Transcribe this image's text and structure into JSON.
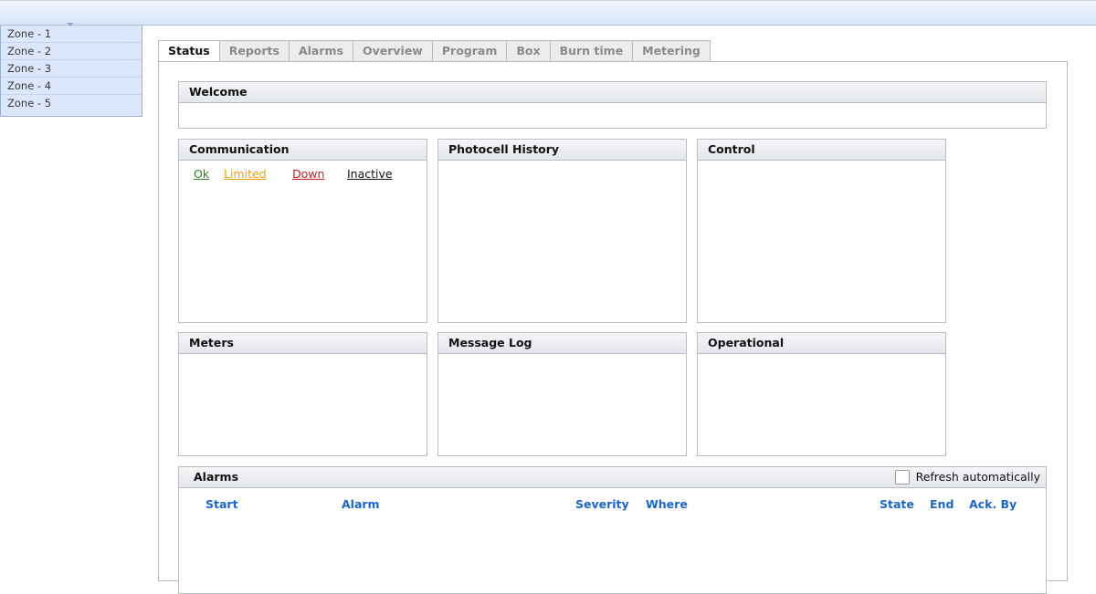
{
  "zones": [
    "Zone - 1",
    "Zone - 2",
    "Zone - 3",
    "Zone - 4",
    "Zone - 5"
  ],
  "tabs": [
    "Status",
    "Reports",
    "Alarms",
    "Overview",
    "Program",
    "Box",
    "Burn time",
    "Metering"
  ],
  "panels": {
    "welcome": "Welcome",
    "communication": "Communication",
    "photocell_history": "Photocell History",
    "control": "Control",
    "meters": "Meters",
    "message_log": "Message Log",
    "operational": "Operational",
    "alarms": "Alarms"
  },
  "communication_legend": {
    "ok": "Ok",
    "limited": "Limited",
    "down": "Down",
    "inactive": "Inactive"
  },
  "alarms_table": {
    "refresh_label": "Refresh automatically",
    "refresh_checked": false,
    "columns": [
      "Start",
      "Alarm",
      "Severity",
      "Where",
      "State",
      "End",
      "Ack. By"
    ]
  },
  "colors": {
    "ok": "#2a8a1e",
    "limited": "#e8a300",
    "down": "#d11a1a",
    "column_header": "#1a66d1"
  }
}
